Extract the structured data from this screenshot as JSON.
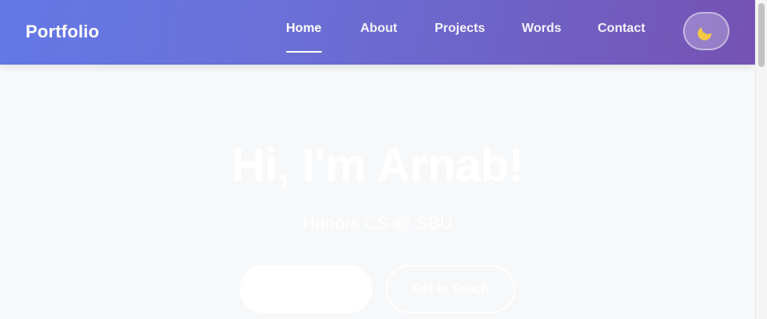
{
  "header": {
    "brand": "Portfolio",
    "nav": [
      {
        "label": "Home",
        "active": true
      },
      {
        "label": "About",
        "active": false
      },
      {
        "label": "Projects",
        "active": false
      },
      {
        "label": "Words",
        "active": false
      },
      {
        "label": "Contact",
        "active": false
      }
    ],
    "theme_toggle_icon": "moon-icon",
    "gradient_colors": [
      "#6478e6",
      "#7552b3"
    ]
  },
  "hero": {
    "title": "Hi, I'm Arnab!",
    "subtitle": "Honors CS @ SBU",
    "primary_button_label": "",
    "secondary_button_label": "Get In Touch"
  },
  "colors": {
    "page_background": "#f7f8fa",
    "hero_text": "#ffffff",
    "moon": "#f5c842"
  }
}
